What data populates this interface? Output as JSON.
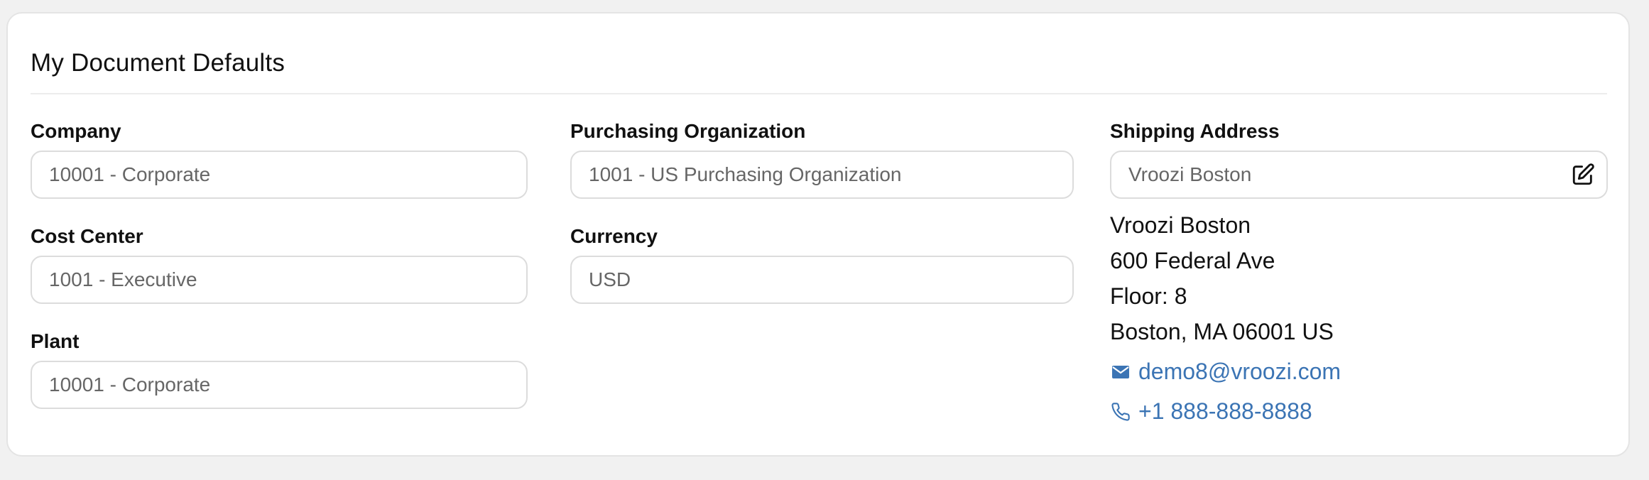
{
  "card": {
    "title": "My Document Defaults"
  },
  "fields": {
    "company": {
      "label": "Company",
      "value": "10001 - Corporate"
    },
    "cost_center": {
      "label": "Cost Center",
      "value": "1001 - Executive"
    },
    "plant": {
      "label": "Plant",
      "value": "10001 - Corporate"
    },
    "purchasing_org": {
      "label": "Purchasing Organization",
      "value": "1001 - US Purchasing Organization"
    },
    "currency": {
      "label": "Currency",
      "value": "USD"
    },
    "shipping_address": {
      "label": "Shipping Address",
      "value": "Vroozi Boston"
    }
  },
  "address": {
    "name": "Vroozi Boston",
    "street": "600 Federal Ave",
    "floor": "Floor: 8",
    "city_line": "Boston, MA 06001 US",
    "email": "demo8@vroozi.com",
    "phone": "+1 888-888-8888"
  },
  "icons": {
    "edit": "edit-icon",
    "email": "mail-icon",
    "phone": "phone-icon"
  },
  "colors": {
    "link": "#3b74b4",
    "border": "#dcdcdc",
    "placeholder_text": "#666666"
  }
}
